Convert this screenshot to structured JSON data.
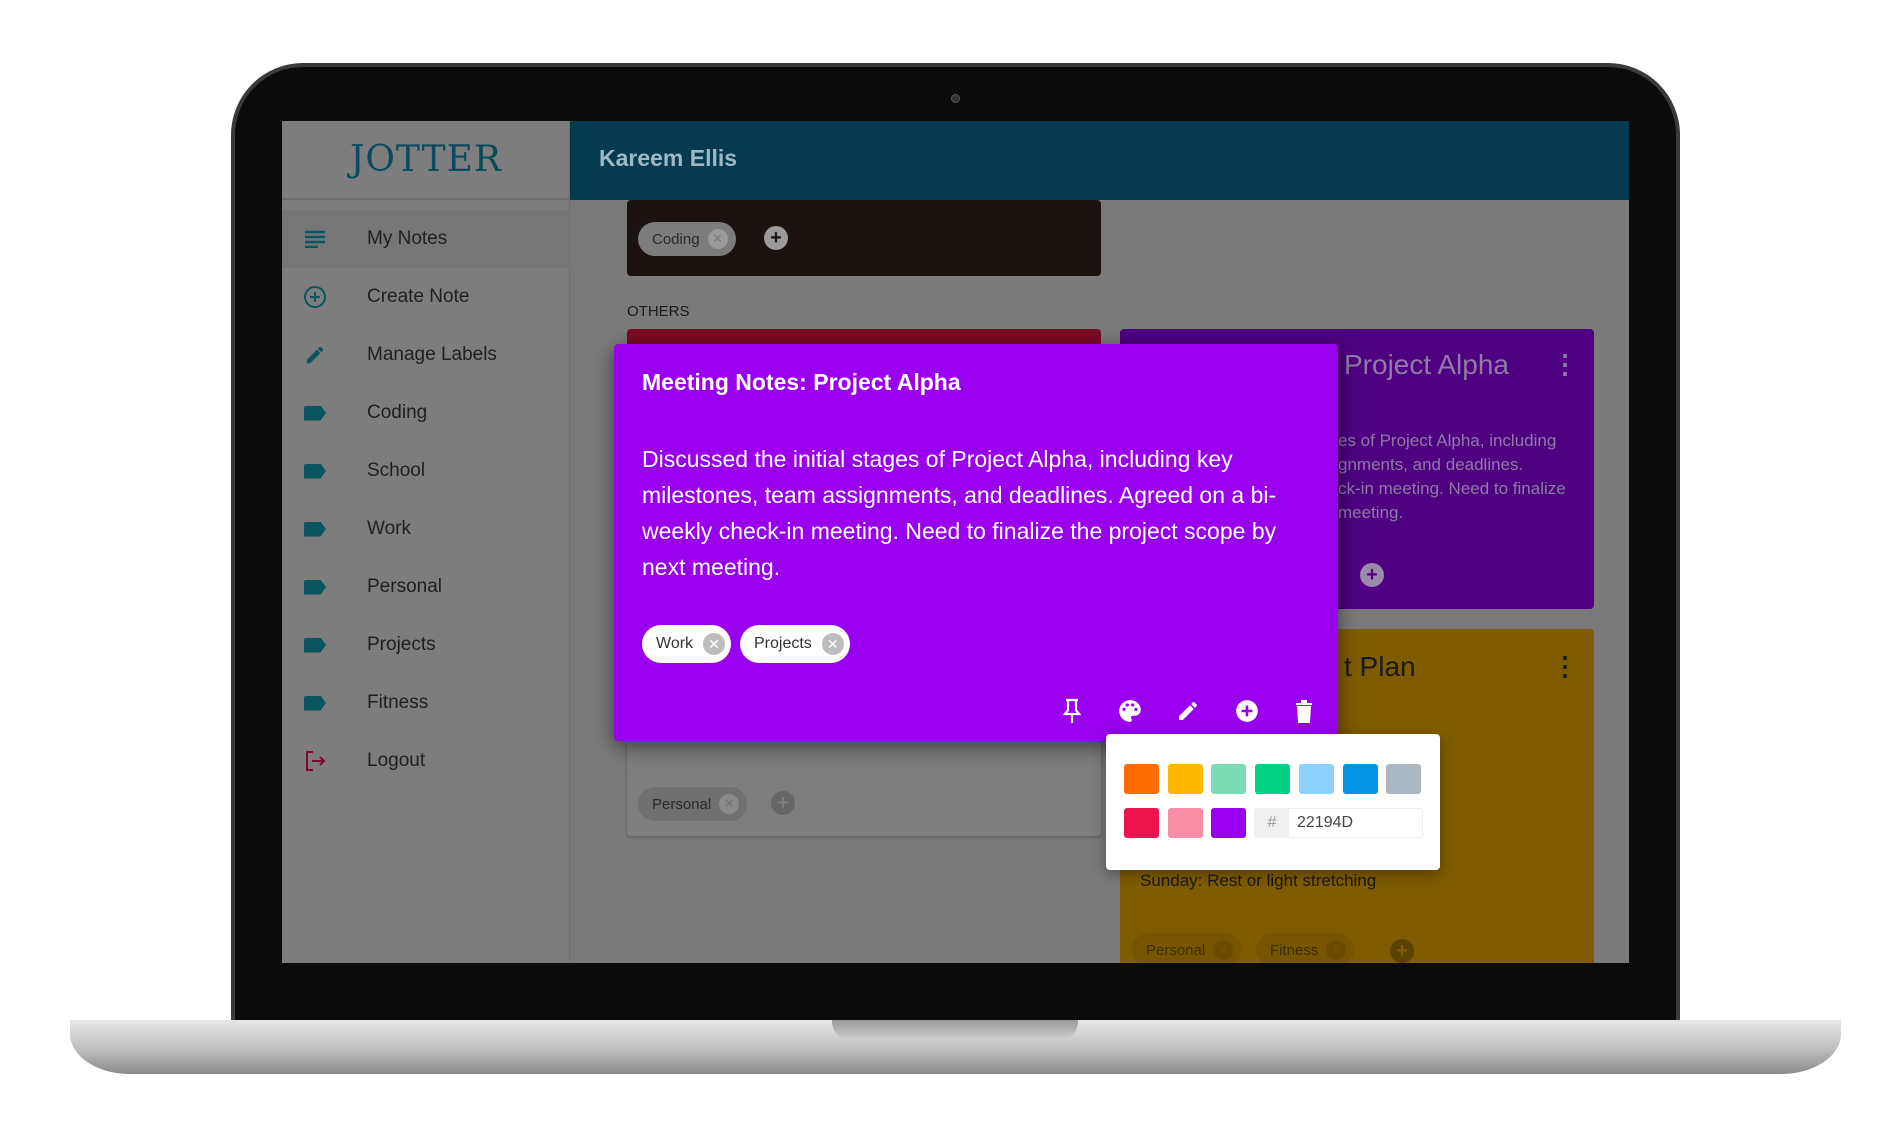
{
  "app": {
    "logo": "JOTTER",
    "user_name": "Kareem Ellis"
  },
  "sidebar": {
    "items": [
      {
        "label": "My Notes",
        "icon": "notes-icon",
        "selected": true
      },
      {
        "label": "Create Note",
        "icon": "add-circle-icon"
      },
      {
        "label": "Manage Labels",
        "icon": "pencil-icon"
      },
      {
        "label": "Coding",
        "icon": "label-icon"
      },
      {
        "label": "School",
        "icon": "label-icon"
      },
      {
        "label": "Work",
        "icon": "label-icon"
      },
      {
        "label": "Personal",
        "icon": "label-icon"
      },
      {
        "label": "Projects",
        "icon": "label-icon"
      },
      {
        "label": "Fitness",
        "icon": "label-icon"
      },
      {
        "label": "Logout",
        "icon": "logout-icon"
      }
    ]
  },
  "main": {
    "pinned_card": {
      "labels": [
        "Coding"
      ]
    },
    "others_heading": "OTHERS",
    "personal_card": {
      "labels": [
        "Personal"
      ]
    },
    "purple_card": {
      "title_visible": "Project Alpha",
      "body_visible": [
        "es of Project Alpha, including",
        "gnments, and deadlines.",
        "ck-in meeting. Need to finalize",
        "meeting."
      ]
    },
    "yellow_card": {
      "title_visible": "t Plan",
      "body_visible": "Sunday: Rest or light stretching",
      "labels": [
        "Personal",
        "Fitness"
      ]
    }
  },
  "modal": {
    "title": "Meeting Notes: Project Alpha",
    "body": "Discussed the initial stages of Project Alpha, including key milestones, team assignments, and deadlines. Agreed on a bi-weekly check-in meeting. Need to finalize the project scope by next meeting.",
    "labels": [
      "Work",
      "Projects"
    ],
    "color": "#9900EE",
    "actions": [
      "pin-icon",
      "palette-icon",
      "edit-icon",
      "add-label-icon",
      "delete-icon"
    ]
  },
  "palette": {
    "swatches": [
      "#FF6D00",
      "#FFB900",
      "#7BDCB5",
      "#00D084",
      "#8ED1FC",
      "#0693E3",
      "#ABB8C3",
      "#EB144C",
      "#F78DA7",
      "#9900EF"
    ],
    "hash": "#",
    "hex_value": "22194D"
  }
}
